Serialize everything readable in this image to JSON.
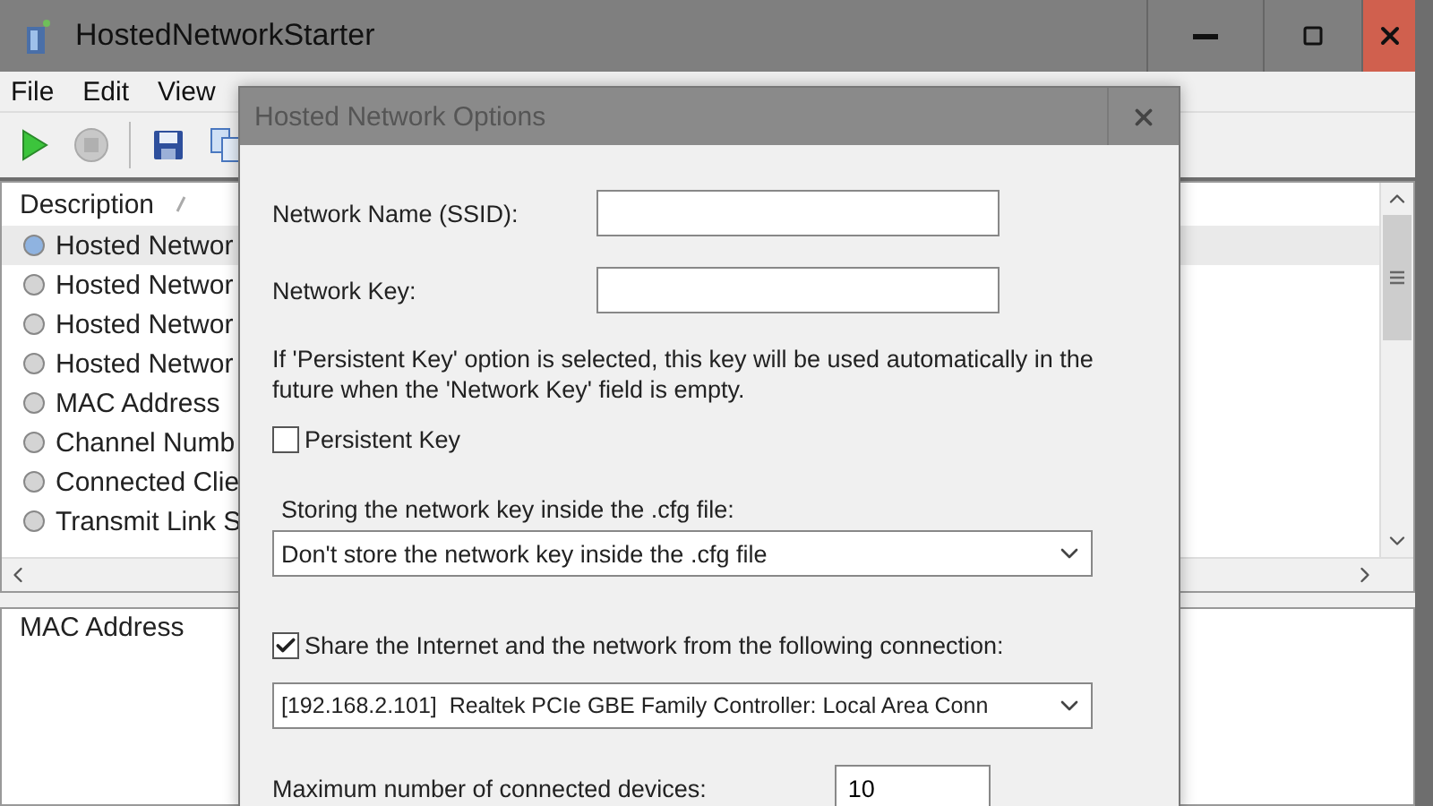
{
  "window": {
    "title": "HostedNetworkStarter"
  },
  "menu": [
    "File",
    "Edit",
    "View"
  ],
  "toolbar": [
    {
      "kind": "play"
    },
    {
      "kind": "stop"
    },
    {
      "kind": "separator"
    },
    {
      "kind": "save"
    },
    {
      "kind": "copy"
    }
  ],
  "list": {
    "columns": [
      "Description"
    ],
    "rows": [
      {
        "label": "Hosted Networ",
        "selected": true
      },
      {
        "label": "Hosted Networ",
        "selected": false
      },
      {
        "label": "Hosted Networ",
        "selected": false
      },
      {
        "label": "Hosted Networ",
        "selected": false
      },
      {
        "label": "MAC Address",
        "selected": false
      },
      {
        "label": "Channel Numb",
        "selected": false
      },
      {
        "label": "Connected Clie",
        "selected": false
      },
      {
        "label": "Transmit Link S",
        "selected": false
      }
    ]
  },
  "details": {
    "columns": [
      "MAC Address"
    ]
  },
  "dialog": {
    "title": "Hosted Network Options",
    "fields": [
      {
        "label": "Network Name (SSID):"
      },
      {
        "label": "Network Key:"
      }
    ],
    "note": "If 'Persistent Key' option is selected, this key will be used automatically in the future when the 'Network Key' field is empty.",
    "persistent_key": {
      "label": "Persistent Key",
      "checked": false
    },
    "storage": {
      "label": "Storing the network key inside the .cfg file:",
      "value": "Don't store the network key inside the .cfg file"
    },
    "share": {
      "label": "Share the Internet and the network from the following connection:",
      "checked": true
    },
    "connection": {
      "value": "[192.168.2.101]  Realtek PCIe GBE Family Controller: Local Area Conn"
    },
    "max_devices": {
      "label": "Maximum number of connected devices:",
      "value": "10"
    }
  }
}
